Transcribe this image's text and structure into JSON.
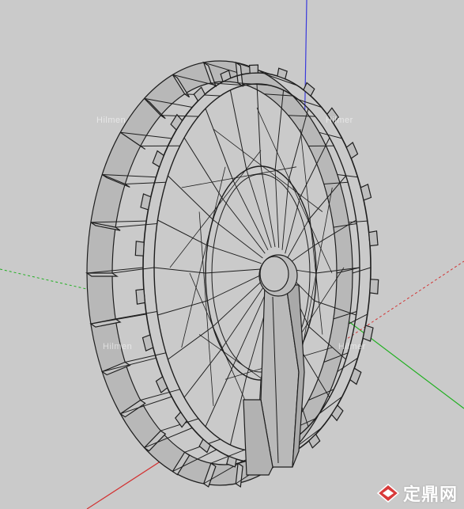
{
  "watermark": {
    "text": "Hilmen",
    "text2": "Hilmer"
  },
  "logo": {
    "text": "定鼎网",
    "icon": "dingding-logo-icon"
  },
  "colors": {
    "background": "#cacaca",
    "model_fill": "#b4b4b4",
    "model_edge": "#1e1e1e",
    "axis_red": "#d23232",
    "axis_green": "#22b022",
    "axis_blue": "#3a3adc"
  }
}
